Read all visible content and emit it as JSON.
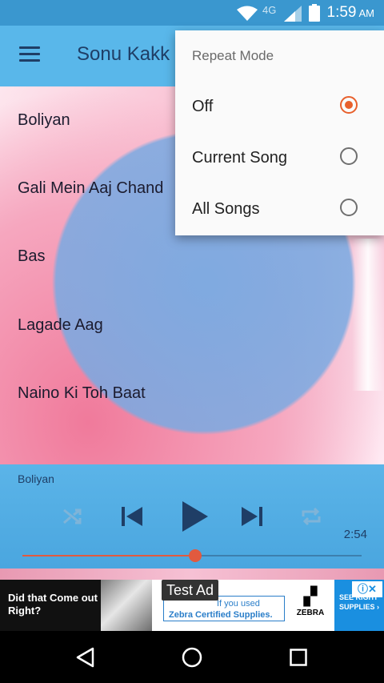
{
  "status_bar": {
    "network": "4G",
    "time": "1:59",
    "ampm": "AM",
    "icons": [
      "wifi-icon",
      "signal-icon",
      "battery-icon"
    ]
  },
  "app_bar": {
    "title": "Sonu Kakk",
    "menu_icon": "hamburger-icon"
  },
  "songs": [
    "Boliyan",
    "Gali Mein Aaj Chand",
    "Bas",
    "Lagade Aag",
    "Naino Ki Toh Baat"
  ],
  "player": {
    "now_playing": "Boliyan",
    "duration": "2:54",
    "progress_fraction": 0.51,
    "controls": [
      "shuffle-icon",
      "previous-icon",
      "play-icon",
      "next-icon",
      "repeat-icon"
    ]
  },
  "repeat_menu": {
    "title": "Repeat Mode",
    "options": [
      {
        "label": "Off",
        "selected": true
      },
      {
        "label": "Current Song",
        "selected": false
      },
      {
        "label": "All Songs",
        "selected": false
      }
    ]
  },
  "ad": {
    "badge": "Test Ad",
    "headline": "Did that Come out Right?",
    "mid_text_1": "If you used",
    "mid_text_2": "Zebra Certified Supplies.",
    "brand": "ZEBRA",
    "cta": "SEE RIGHT SUPPLIES ›"
  },
  "nav_bar": {
    "buttons": [
      "back-icon",
      "home-icon",
      "recents-icon"
    ]
  },
  "colors": {
    "accent": "#e8602c",
    "app_bar": "#59b7ea",
    "status_bar": "#3a97cf",
    "player_bg": "#4aa6df"
  }
}
